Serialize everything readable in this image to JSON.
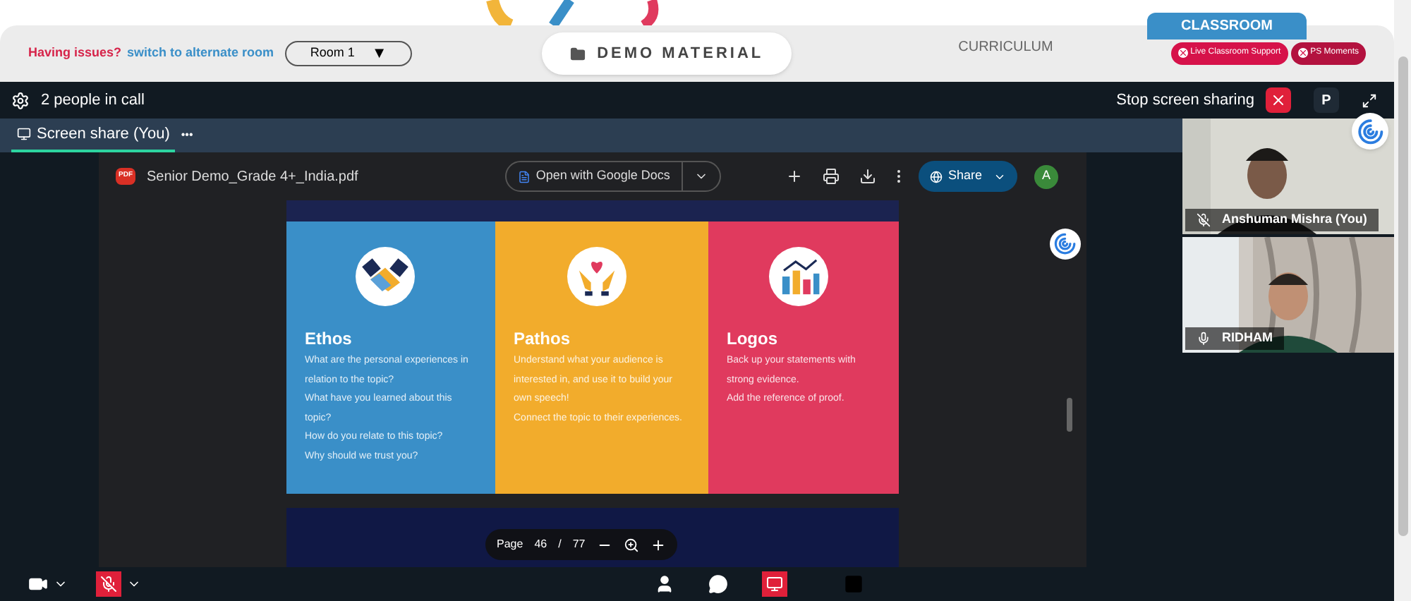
{
  "topbar": {
    "issue_text": "Having issues?",
    "switch_link": "switch to alternate room",
    "room_select": "Room 1",
    "room_caret": "▼",
    "demo_button": "DEMO MATERIAL",
    "curriculum_tab": "CURRICULUM",
    "classroom_tab": "CLASSROOM",
    "support_buttons": [
      "Live Classroom Support",
      "PS Moments"
    ]
  },
  "call_header": {
    "people": "2 people in call",
    "stop_sharing": "Stop screen sharing",
    "avatar_letter": "P"
  },
  "tabs": [
    {
      "label": "Screen share (You)",
      "selected": true
    }
  ],
  "tab_more": "•••",
  "pdf": {
    "filename": "Senior Demo_Grade 4+_India.pdf",
    "pdf_badge": "PDF",
    "open_with": "Open with Google Docs",
    "share": "Share",
    "account": "A",
    "columns": [
      {
        "title": "Ethos",
        "color": "#3a8fc8",
        "lines": [
          "What are the personal experiences in relation to the topic?",
          "What have you learned about this topic?",
          "How do you relate to this topic?",
          "Why should we trust you?"
        ]
      },
      {
        "title": "Pathos",
        "color": "#f2ac2c",
        "lines": [
          "Understand what your audience is interested in, and use it to build your own speech!",
          "Connect the topic to their experiences."
        ]
      },
      {
        "title": "Logos",
        "color": "#e03a5e",
        "lines": [
          "Back up your statements with strong evidence.",
          "Add the reference of proof."
        ]
      }
    ],
    "page_label": "Page",
    "page": "46",
    "page_sep": "/",
    "page_total": "77"
  },
  "participants": [
    {
      "name": "Anshuman Mishra (You)",
      "muted": true
    },
    {
      "name": "RIDHAM",
      "muted": false
    }
  ],
  "toolbar": {
    "mic_muted": true,
    "screen_sharing": true
  }
}
